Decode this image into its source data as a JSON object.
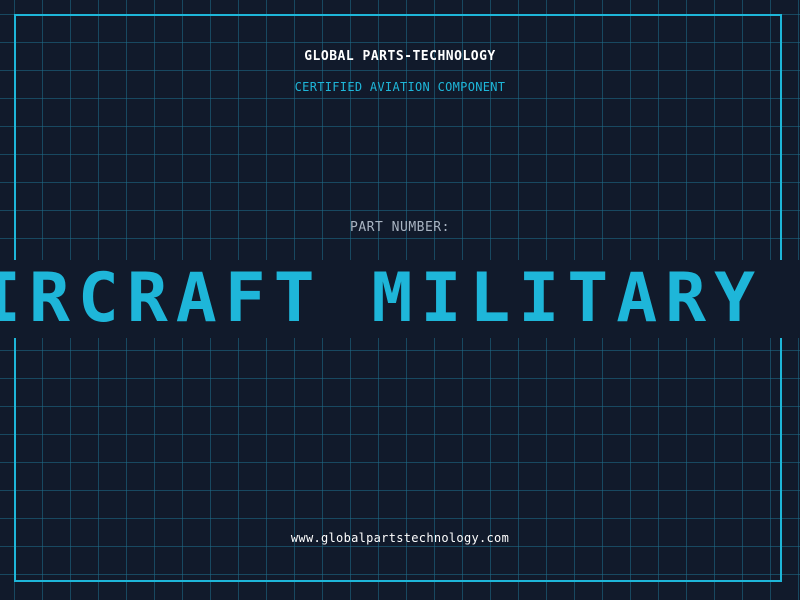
{
  "header": {
    "brand": "GLOBAL PARTS-TECHNOLOGY",
    "subtitle": "CERTIFIED AVIATION COMPONENT"
  },
  "part": {
    "label": "PART NUMBER:",
    "value": "IRCRAFT MILITARY H"
  },
  "footer": {
    "website": "www.globalpartstechnology.com"
  },
  "colors": {
    "background": "#111a2b",
    "grid": "#1e6e8c",
    "accent": "#1eb6d9",
    "text_primary": "#ffffff",
    "text_muted": "#a9b4c2"
  }
}
